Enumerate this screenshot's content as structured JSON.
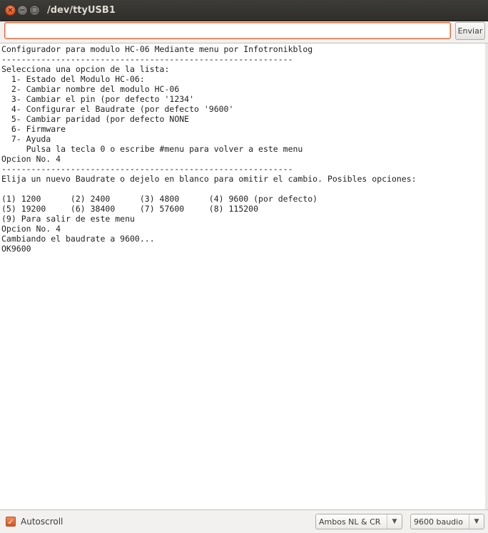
{
  "window": {
    "title": "/dev/ttyUSB1"
  },
  "send": {
    "input_value": "",
    "button_label": "Enviar"
  },
  "console": {
    "lines": [
      "Configurador para modulo HC-06 Mediante menu por Infotronikblog",
      "-----------------------------------------------------------",
      "Selecciona una opcion de la lista:",
      "  1- Estado del Modulo HC-06:",
      "  2- Cambiar nombre del modulo HC-06",
      "  3- Cambiar el pin (por defecto '1234'",
      "  4- Configurar el Baudrate (por defecto '9600'",
      "  5- Cambiar paridad (por defecto NONE",
      "  6- Firmware",
      "  7- Ayuda",
      "     Pulsa la tecla 0 o escribe #menu para volver a este menu",
      "Opcion No. 4",
      "-----------------------------------------------------------",
      "Elija un nuevo Baudrate o dejelo en blanco para omitir el cambio. Posibles opciones:",
      "",
      "(1) 1200      (2) 2400      (3) 4800      (4) 9600 (por defecto)",
      "(5) 19200     (6) 38400     (7) 57600     (8) 115200",
      "(9) Para salir de este menu",
      "Opcion No. 4",
      "Cambiando el baudrate a 9600...",
      "OK9600"
    ]
  },
  "footer": {
    "autoscroll_label": "Autoscroll",
    "autoscroll_checked": true,
    "line_ending_value": "Ambos NL & CR",
    "baud_rate_value": "9600 baudio"
  }
}
